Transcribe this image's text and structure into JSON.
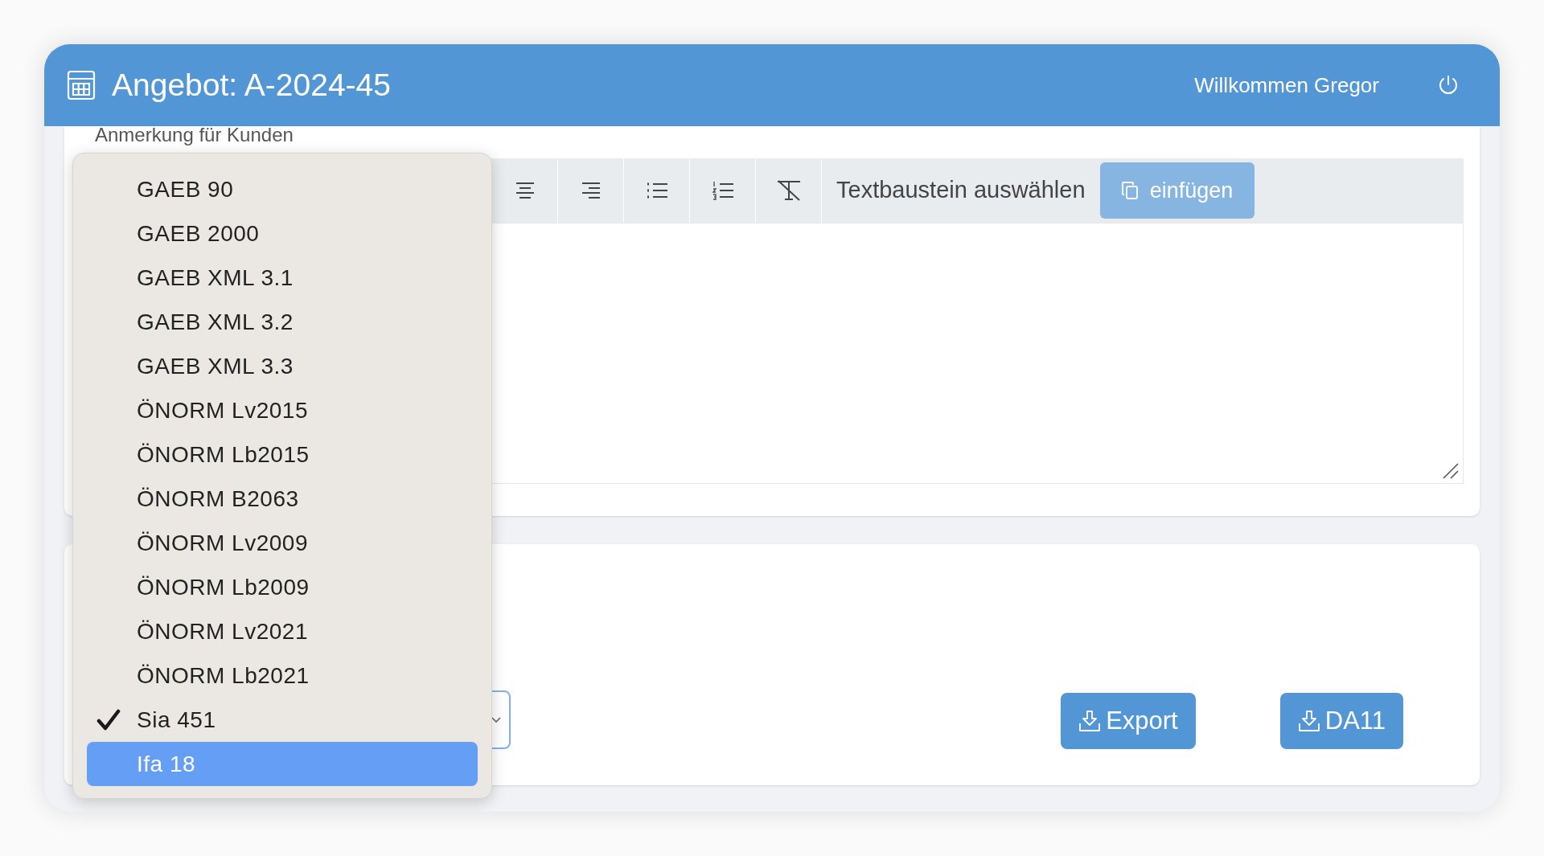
{
  "header": {
    "title": "Angebot: A-2024-45",
    "welcome": "Willkommen Gregor"
  },
  "note_section": {
    "label": "Anmerkung für Kunden",
    "toolbar": {
      "tools": [
        {
          "kind": "align-center"
        },
        {
          "kind": "align-right"
        },
        {
          "kind": "bullet-list"
        },
        {
          "kind": "numbered-list"
        },
        {
          "kind": "clear-format"
        }
      ],
      "snippet_select": "Textbaustein auswählen",
      "insert_button": {
        "label": "einfügen",
        "disabled": true
      }
    }
  },
  "export_section": {
    "buttons": [
      "Export",
      "DA11"
    ]
  },
  "format_dropdown": {
    "options": [
      {
        "label": "GAEB 90",
        "selected": false,
        "hovered": false
      },
      {
        "label": "GAEB 2000",
        "selected": false,
        "hovered": false
      },
      {
        "label": "GAEB XML 3.1",
        "selected": false,
        "hovered": false
      },
      {
        "label": "GAEB XML 3.2",
        "selected": false,
        "hovered": false
      },
      {
        "label": "GAEB XML 3.3",
        "selected": false,
        "hovered": false
      },
      {
        "label": "ÖNORM Lv2015",
        "selected": false,
        "hovered": false
      },
      {
        "label": "ÖNORM Lb2015",
        "selected": false,
        "hovered": false
      },
      {
        "label": "ÖNORM B2063",
        "selected": false,
        "hovered": false
      },
      {
        "label": "ÖNORM Lv2009",
        "selected": false,
        "hovered": false
      },
      {
        "label": "ÖNORM Lb2009",
        "selected": false,
        "hovered": false
      },
      {
        "label": "ÖNORM Lv2021",
        "selected": false,
        "hovered": false
      },
      {
        "label": "ÖNORM Lb2021",
        "selected": false,
        "hovered": false
      },
      {
        "label": "Sia 451",
        "selected": true,
        "hovered": false
      },
      {
        "label": "Ifa 18",
        "selected": false,
        "hovered": true
      }
    ]
  }
}
